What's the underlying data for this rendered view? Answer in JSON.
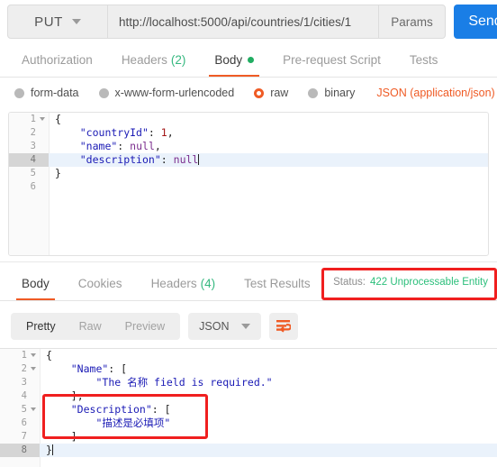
{
  "request": {
    "method": "PUT",
    "url": "http://localhost:5000/api/countries/1/cities/1",
    "params_label": "Params",
    "send_label": "Send",
    "tabs": [
      {
        "label": "Authorization",
        "active": false
      },
      {
        "label": "Headers",
        "count": "(2)",
        "active": false
      },
      {
        "label": "Body",
        "active": true,
        "dot": true
      },
      {
        "label": "Pre-request Script",
        "active": false
      },
      {
        "label": "Tests",
        "active": false
      }
    ],
    "body_types": [
      {
        "label": "form-data",
        "selected": false
      },
      {
        "label": "x-www-form-urlencoded",
        "selected": false
      },
      {
        "label": "raw",
        "selected": true
      },
      {
        "label": "binary",
        "selected": false
      }
    ],
    "content_type": "JSON (application/json)",
    "body_lines": [
      {
        "n": "1",
        "fold": true,
        "active": false,
        "text": "{"
      },
      {
        "n": "2",
        "fold": false,
        "active": false,
        "text": "    \"countryId\": 1,"
      },
      {
        "n": "3",
        "fold": false,
        "active": false,
        "text": "    \"name\": null,"
      },
      {
        "n": "4",
        "fold": false,
        "active": true,
        "text": "    \"description\": null"
      },
      {
        "n": "5",
        "fold": false,
        "active": false,
        "text": "}"
      },
      {
        "n": "6",
        "fold": false,
        "active": false,
        "text": ""
      }
    ]
  },
  "response": {
    "tabs": [
      {
        "label": "Body",
        "active": true
      },
      {
        "label": "Cookies",
        "active": false
      },
      {
        "label": "Headers",
        "count": "(4)",
        "active": false
      },
      {
        "label": "Test Results",
        "active": false
      }
    ],
    "status_label": "Status:",
    "status_value": "422 Unprocessable Entity",
    "view_modes": [
      {
        "label": "Pretty",
        "active": true
      },
      {
        "label": "Raw",
        "active": false
      },
      {
        "label": "Preview",
        "active": false
      }
    ],
    "format": "JSON",
    "wrap_icon": "word-wrap-icon",
    "body_lines": [
      {
        "n": "1",
        "fold": true,
        "active": false,
        "text": "{"
      },
      {
        "n": "2",
        "fold": true,
        "active": false,
        "text": "    \"Name\": ["
      },
      {
        "n": "3",
        "fold": false,
        "active": false,
        "text": "        \"The 名称 field is required.\""
      },
      {
        "n": "4",
        "fold": false,
        "active": false,
        "text": "    ],"
      },
      {
        "n": "5",
        "fold": true,
        "active": false,
        "text": "    \"Description\": ["
      },
      {
        "n": "6",
        "fold": false,
        "active": false,
        "text": "        \"描述是必填项\""
      },
      {
        "n": "7",
        "fold": false,
        "active": false,
        "text": "    ]"
      },
      {
        "n": "8",
        "fold": false,
        "active": true,
        "text": "}"
      }
    ]
  },
  "annotations": [
    {
      "name": "status-highlight"
    },
    {
      "name": "description-error-highlight"
    }
  ],
  "colors": {
    "accent_orange": "#ef5b25",
    "send_blue": "#1a7ee6",
    "status_green": "#2cbf7b",
    "annotation_red": "#f01f1f",
    "json_string": "#1a1ab5"
  }
}
